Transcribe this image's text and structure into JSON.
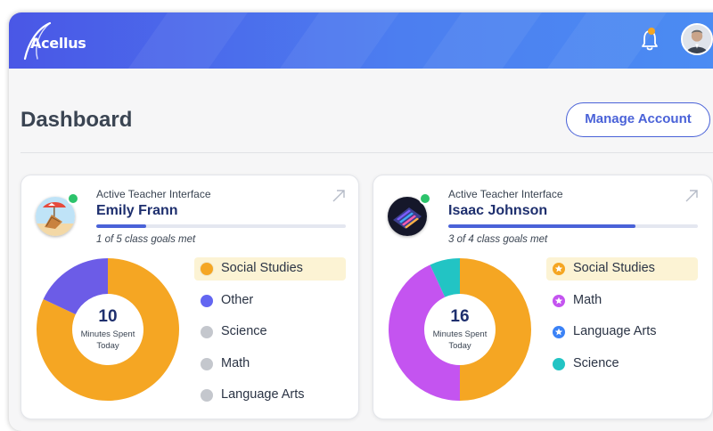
{
  "app": {
    "brand": "Acellus"
  },
  "header": {
    "notification_icon": "bell-icon",
    "avatar_icon": "user-avatar"
  },
  "page": {
    "title": "Dashboard",
    "manage_label": "Manage Account"
  },
  "cards": [
    {
      "subtitle": "Active Teacher Interface",
      "name": "Emily Frann",
      "goals_text": "1 of 5 class goals met",
      "goals_met": 1,
      "goals_total": 5,
      "avatar_icon": "beach-chair-icon",
      "status_color": "#2cc36b",
      "minutes": "10",
      "minutes_label": "Minutes Spent Today",
      "chart_data": {
        "type": "pie",
        "categories": [
          "Social Studies",
          "Other",
          "Science",
          "Math",
          "Language Arts"
        ],
        "values": [
          8.2,
          1.8,
          0,
          0,
          0
        ],
        "colors": [
          "#f5a623",
          "#6c5ce7",
          "#c4c7cd",
          "#c4c7cd",
          "#c4c7cd"
        ],
        "legend": "right"
      },
      "legend": [
        {
          "label": "Social Studies",
          "color": "#f5a623",
          "icon": "dot",
          "active": true
        },
        {
          "label": "Other",
          "color": "#6366f1",
          "icon": "dot",
          "active": false
        },
        {
          "label": "Science",
          "color": "#c4c7cd",
          "icon": "dot",
          "active": false
        },
        {
          "label": "Math",
          "color": "#c4c7cd",
          "icon": "dot",
          "active": false
        },
        {
          "label": "Language Arts",
          "color": "#c4c7cd",
          "icon": "dot",
          "active": false
        }
      ]
    },
    {
      "subtitle": "Active Teacher Interface",
      "name": "Isaac Johnson",
      "goals_text": "3 of 4 class goals met",
      "goals_met": 3,
      "goals_total": 4,
      "avatar_icon": "keyboard-icon",
      "status_color": "#2cc36b",
      "minutes": "16",
      "minutes_label": "Minutes Spent Today",
      "chart_data": {
        "type": "pie",
        "categories": [
          "Social Studies",
          "Math",
          "Language Arts",
          "Science"
        ],
        "values": [
          8,
          6.9,
          0,
          1.1
        ],
        "colors": [
          "#f5a623",
          "#c454f0",
          "#3b82f6",
          "#22c4c4"
        ],
        "legend": "right"
      },
      "legend": [
        {
          "label": "Social Studies",
          "color": "#f5a623",
          "icon": "star",
          "active": true
        },
        {
          "label": "Math",
          "color": "#c454f0",
          "icon": "star",
          "active": false
        },
        {
          "label": "Language Arts",
          "color": "#3b82f6",
          "icon": "star",
          "active": false
        },
        {
          "label": "Science",
          "color": "#22c4c4",
          "icon": "dot",
          "active": false
        }
      ]
    }
  ]
}
